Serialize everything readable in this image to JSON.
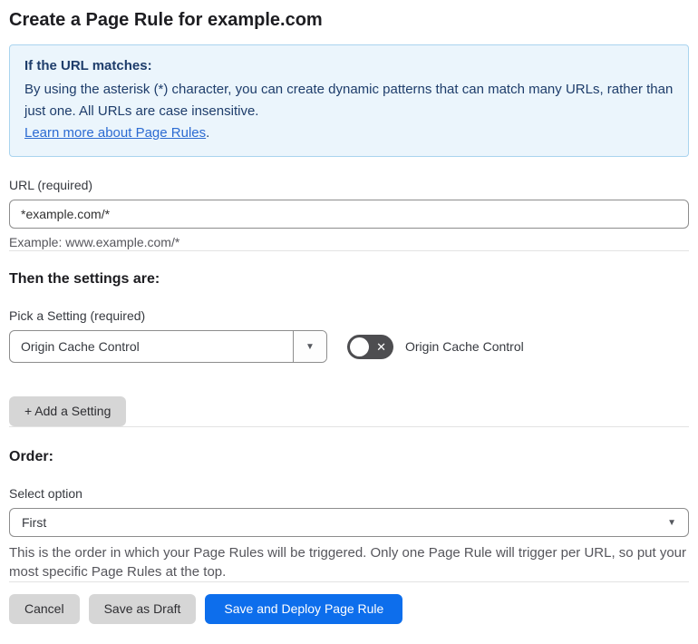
{
  "page": {
    "title": "Create a Page Rule for example.com"
  },
  "info_box": {
    "heading": "If the URL matches:",
    "body": "By using the asterisk (*) character, you can create dynamic patterns that can match many URLs, rather than just one. All URLs are case insensitive.",
    "link": "Learn more about Page Rules",
    "link_suffix": "."
  },
  "url_field": {
    "label": "URL (required)",
    "value": "*example.com/*",
    "help": "Example: www.example.com/*"
  },
  "settings_section": {
    "heading": "Then the settings are:",
    "picker_label": "Pick a Setting (required)",
    "picker_value": "Origin Cache Control",
    "toggle_state": "off",
    "toggle_label": "Origin Cache Control",
    "add_button_label": "+ Add a Setting"
  },
  "order_section": {
    "heading": "Order:",
    "select_label": "Select option",
    "select_value": "First",
    "help": "This is the order in which your Page Rules will be triggered. Only one Page Rule will trigger per URL, so put your most specific Page Rules at the top."
  },
  "footer": {
    "cancel_label": "Cancel",
    "save_draft_label": "Save as Draft",
    "save_deploy_label": "Save and Deploy Page Rule"
  },
  "icons": {
    "toggle_off": "✕",
    "dropdown_arrow": "▼",
    "select_arrow": "▼"
  },
  "colors": {
    "accent_blue": "#0d6eec",
    "info_background": "#ebf5fc",
    "info_border": "#aad4ef",
    "info_text": "#1e3d6b",
    "link_blue": "#2c6bd2",
    "toggle_background": "#4d4d50",
    "button_gray": "#d6d6d6"
  }
}
